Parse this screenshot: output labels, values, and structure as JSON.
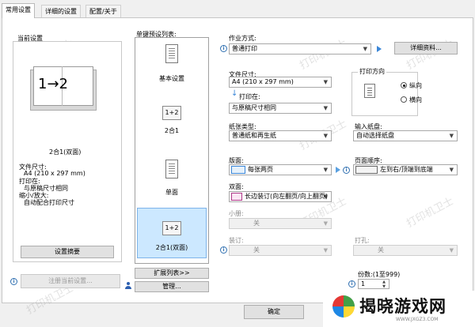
{
  "tabs": [
    "常用设置",
    "详细的设置",
    "配置/关于"
  ],
  "left": {
    "current_title": "当前设置",
    "layout_caption": "2合1(双面)",
    "preview_text": "1→2",
    "details": [
      "文件尺寸:",
      "A4 (210 x 297 mm)",
      "打印在:",
      "与原稿尺寸相同",
      "缩小/放大:",
      "自动配合打印尺寸"
    ],
    "summary_button": "设置摘要",
    "register_button": "注册当前设置..."
  },
  "presets": {
    "title": "单键预设列表:",
    "items": [
      {
        "label": "基本设置",
        "icon": "document-icon"
      },
      {
        "label": "2合1",
        "icon": "1+2"
      },
      {
        "label": "单面",
        "icon": "document-icon"
      },
      {
        "label": "2合1(双面)",
        "icon": "1+2"
      }
    ],
    "expand_button": "扩展列表>>",
    "manage_button": "管理..."
  },
  "right": {
    "job_label": "作业方式:",
    "job_value": "普通打印",
    "detail_button": "详细资料...",
    "paper_size_label": "文件尺寸:",
    "paper_size_value": "A4 (210 x 297 mm)",
    "print_on_label": "打印在:",
    "print_on_value": "与原稿尺寸相同",
    "orientation_label": "打印方向",
    "orient_portrait": "纵向",
    "orient_landscape": "横向",
    "paper_type_label": "纸张类型:",
    "paper_type_value": "普通纸和再生纸",
    "input_tray_label": "输入纸盘:",
    "input_tray_value": "自动选择纸盘",
    "layout_label": "版面:",
    "layout_value": "每张两页",
    "page_order_label": "页面顺序:",
    "page_order_value": "左到右/顶端到底端",
    "duplex_label": "双面:",
    "duplex_value": "长边装订(向左翻页/向上翻页)",
    "booklet_label": "小册:",
    "booklet_value": "关",
    "staple_label": "装订:",
    "staple_value": "关",
    "punch_label": "打孔:",
    "punch_value": "关",
    "copies_label": "份数:(1至999)",
    "copies_value": "1"
  },
  "footer": {
    "ok_button": "确定"
  },
  "watermark": "打印机卫士",
  "site_logo": {
    "text": "揭晓游戏网",
    "sub": "WWW.JXGZ3.COM"
  }
}
